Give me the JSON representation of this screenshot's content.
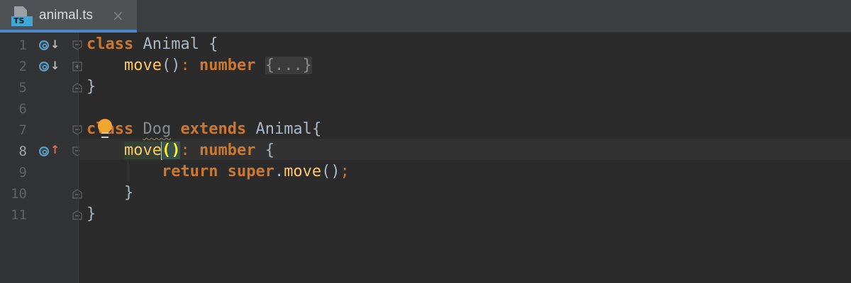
{
  "tab": {
    "title": "animal.ts",
    "icon": "typescript-file-icon",
    "badge": "TS",
    "close_glyph": "×"
  },
  "gutter": {
    "line_numbers": [
      "1",
      "2",
      "5",
      "6",
      "7",
      "8",
      "9",
      "10",
      "11"
    ],
    "current_line": "8"
  },
  "code": {
    "line1": {
      "kw": "class",
      "name": "Animal",
      "brace": "{"
    },
    "line2": {
      "fn": "move",
      "parens": "()",
      "colon": ":",
      "type": "number",
      "placeholder": "{...}"
    },
    "line5": {
      "brace": "}"
    },
    "line7": {
      "kw": "class",
      "name": "Dog",
      "kw2": "extends",
      "base": "Animal",
      "brace": "{"
    },
    "line8": {
      "fn": "move",
      "open_paren": "(",
      "close_paren": ")",
      "colon": ":",
      "type": "number",
      "brace": "{"
    },
    "line9": {
      "kw": "return",
      "kw2": "super",
      "dot": ".",
      "fn": "move",
      "parens": "()",
      "semi": ";"
    },
    "line10": {
      "brace": "}"
    },
    "line11": {
      "brace": "}"
    }
  },
  "colors": {
    "background": "#2b2b2b",
    "gutter": "#313335",
    "keyword": "#cc7832",
    "function": "#ffc66d",
    "text": "#a9b7c6",
    "tab_accent": "#4a88c7",
    "bulb": "#f0a732"
  },
  "icons": [
    "override-method-icon",
    "implementing-method-icon",
    "fold-icon",
    "unfold-icon",
    "intention-bulb-icon"
  ]
}
